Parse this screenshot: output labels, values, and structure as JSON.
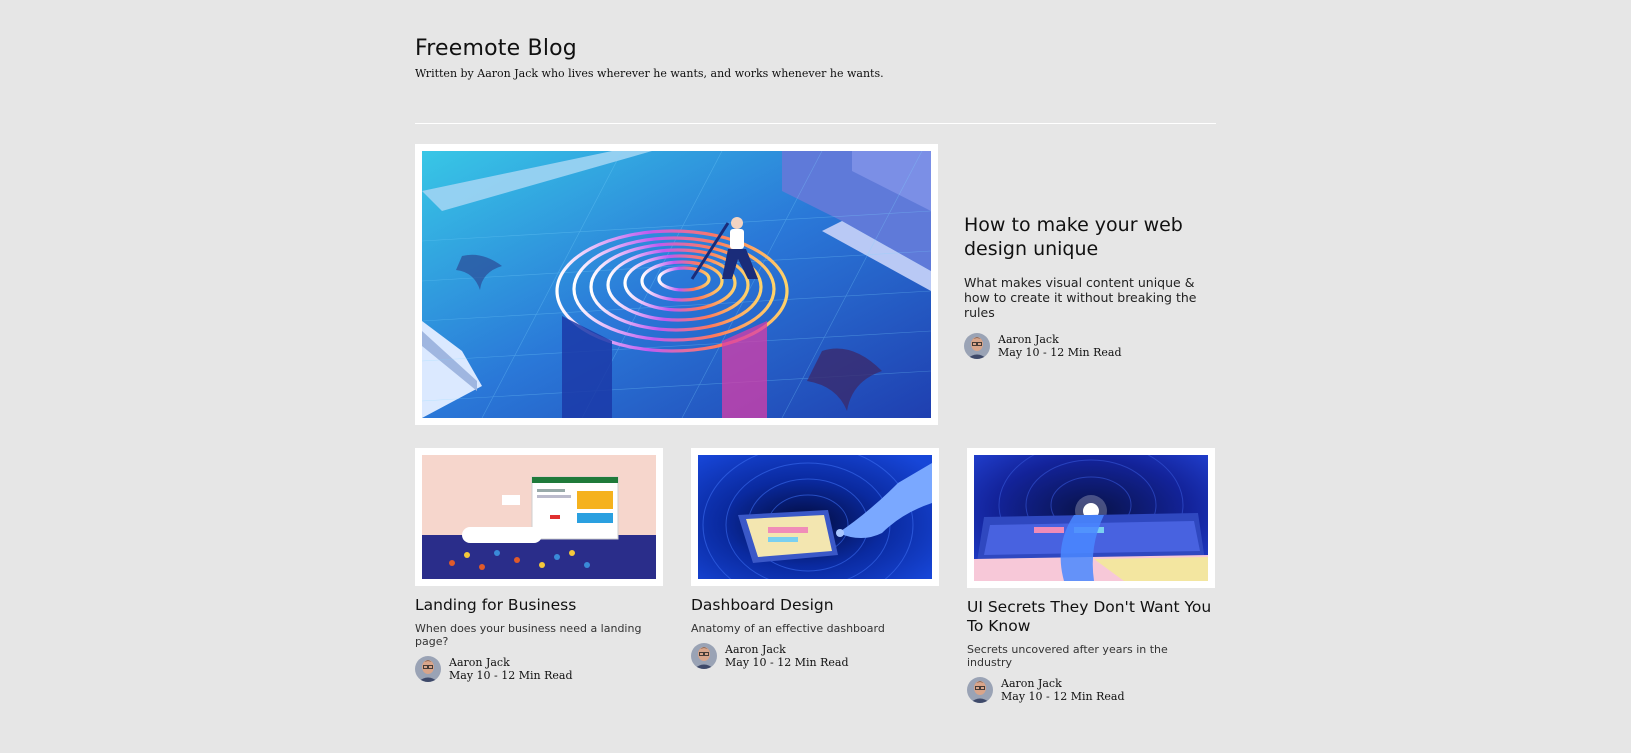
{
  "blog": {
    "title": "Freemote Blog",
    "subtitle": "Written by Aaron Jack who lives wherever he wants, and works whenever he wants."
  },
  "featured": {
    "title": "How to make your web design unique",
    "description": "What makes visual content unique & how to create it without breaking the rules",
    "author": "Aaron Jack",
    "meta": "May 10 - 12 Min Read",
    "image_icon": "fingerprint-pool-illustration"
  },
  "posts": [
    {
      "title": "Landing for Business",
      "description": "When does your business need a landing page?",
      "author": "Aaron Jack",
      "meta": "May 10 - 12 Min Read",
      "image_icon": "landing-page-illustration"
    },
    {
      "title": "Dashboard Design",
      "description": "Anatomy of an effective dashboard",
      "author": "Aaron Jack",
      "meta": "May 10 - 12 Min Read",
      "image_icon": "dashboard-tunnel-illustration"
    },
    {
      "title": "UI Secrets They Don't Want You To Know",
      "description": "Secrets uncovered after years in the industry",
      "author": "Aaron Jack",
      "meta": "May 10 - 12 Min Read",
      "image_icon": "ui-secrets-illustration"
    }
  ],
  "colors": {
    "background": "#e6e6e6",
    "frame": "#ffffff",
    "pool_blue": "#2c6fd6",
    "deep_navy": "#0b1a6e"
  }
}
